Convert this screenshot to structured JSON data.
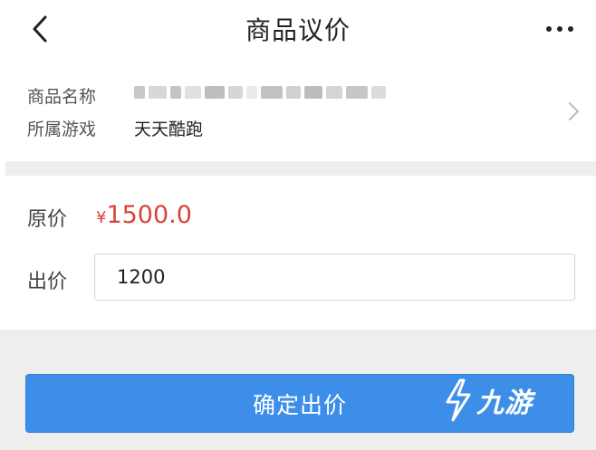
{
  "header": {
    "title": "商品议价",
    "back_icon": "chevron-left-icon",
    "more_icon": "more-horizontal-icon"
  },
  "product": {
    "name_label": "商品名称",
    "game_label": "所属游戏",
    "game_value": "天天酷跑",
    "chevron_icon": "chevron-right-icon"
  },
  "pricing": {
    "original_label": "原价",
    "currency_symbol": "¥",
    "original_price": "1500.0",
    "offer_label": "出价",
    "offer_value": "1200"
  },
  "footer": {
    "confirm_label": "确定出价",
    "watermark_text": "九游",
    "watermark_icon": "jiuyou-logo-icon"
  },
  "colors": {
    "accent_blue": "#3d8ee8",
    "price_red": "#d8443c",
    "background_gray": "#eeeeee"
  }
}
